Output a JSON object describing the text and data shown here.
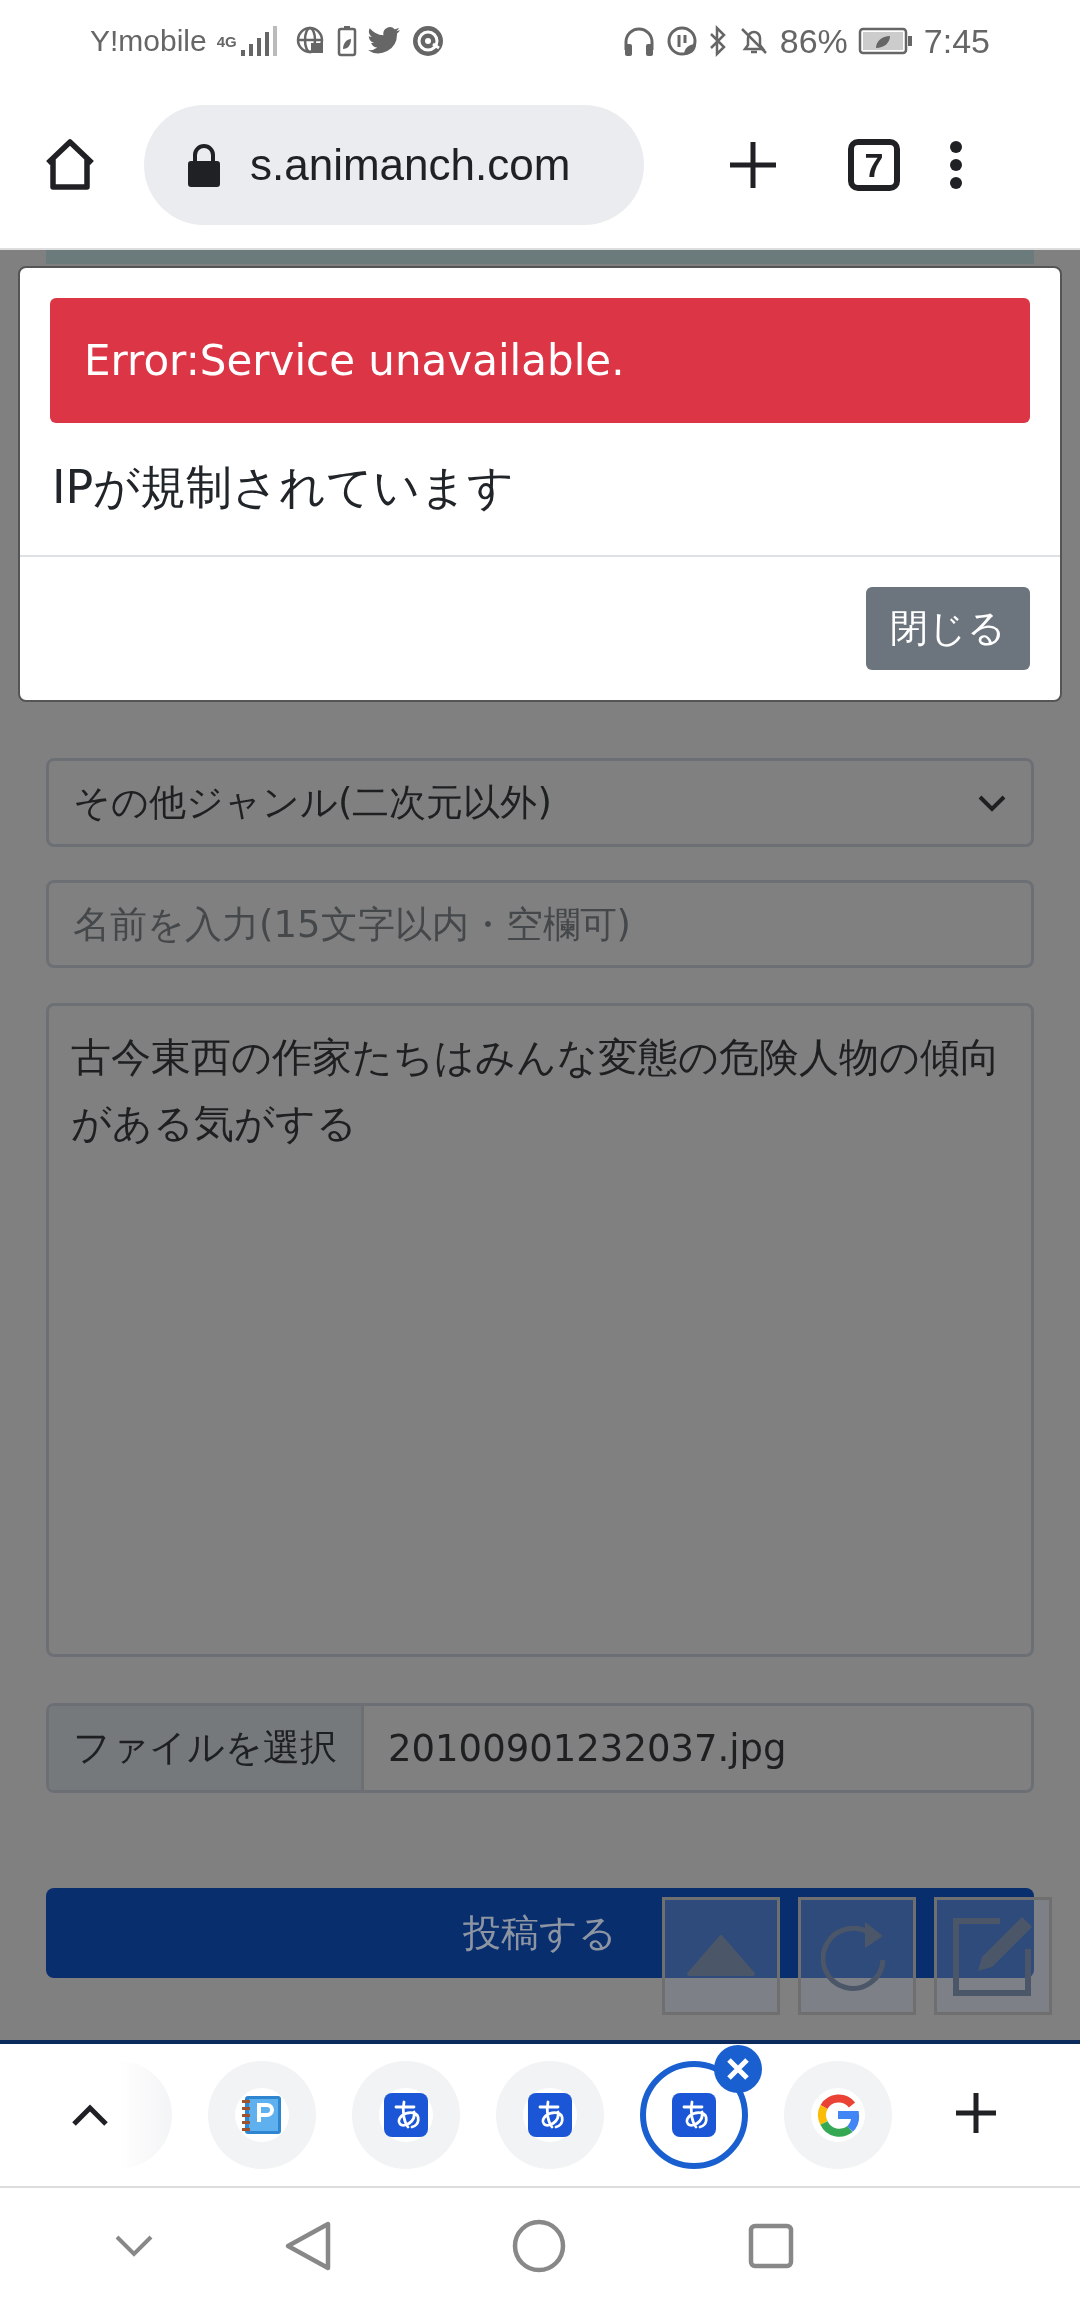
{
  "status_bar": {
    "carrier": "Y!mobile",
    "network": "4G",
    "battery": "86%",
    "time": "7:45"
  },
  "toolbar": {
    "url": "s.animanch.com",
    "tab_count": "7"
  },
  "dialog": {
    "alert": "Error:Service unavailable.",
    "message": "IPが規制されています",
    "close_button": "閉じる"
  },
  "form": {
    "genre_select": "その他ジャンル(二次元以外)",
    "name_field": {
      "placeholder": "名前を入力(15文字以内・空欄可)"
    },
    "body_field": {
      "value": "古今東西の作家たちはみんな変態の危険人物の傾向がある気がする"
    },
    "file_input": {
      "button": "ファイルを選択",
      "filename": "20100901232037.jpg"
    },
    "submit_button": "投稿する"
  },
  "tab_strip": {
    "tabs": [
      {
        "kind": "faded",
        "selected": false
      },
      {
        "kind": "notebook",
        "selected": false
      },
      {
        "kind": "kana",
        "selected": false
      },
      {
        "kind": "kana",
        "selected": false
      },
      {
        "kind": "kana",
        "selected": true
      },
      {
        "kind": "google",
        "selected": false
      }
    ]
  }
}
